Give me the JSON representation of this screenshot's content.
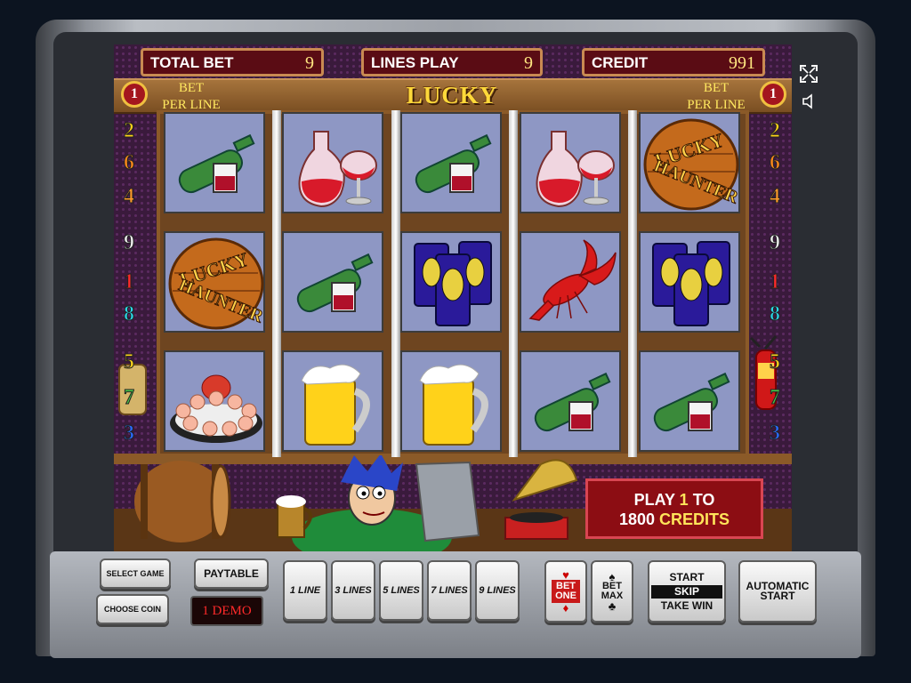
{
  "game": {
    "title": "LUCKY HAUNTER"
  },
  "stats": {
    "total_bet_label": "TOTAL BET",
    "total_bet": "9",
    "lines_play_label": "LINES PLAY",
    "lines_play": "9",
    "credit_label": "CREDIT",
    "credit": "991"
  },
  "bet_per_line": {
    "label_left": "BET\nPER LINE",
    "label_right": "BET\nPER LINE",
    "value_left": "1",
    "value_right": "1"
  },
  "line_numbers_left": [
    "2",
    "6",
    "4",
    "9",
    "1",
    "8",
    "5",
    "7",
    "3"
  ],
  "line_numbers_right": [
    "2",
    "6",
    "4",
    "9",
    "1",
    "8",
    "5",
    "7",
    "3"
  ],
  "reels": [
    [
      "bottle-wine",
      "lucky-haunter",
      "shrimp-dish"
    ],
    [
      "decanter",
      "bottle-wine",
      "beer-mug"
    ],
    [
      "bottle-wine",
      "beer-cans",
      "beer-mug"
    ],
    [
      "decanter",
      "lobster",
      "bottle-wine"
    ],
    [
      "lucky-haunter",
      "beer-cans",
      "bottle-wine"
    ]
  ],
  "play_message": {
    "line1": "PLAY",
    "num1": "1",
    "to": "TO",
    "num2": "1800",
    "credits": "CREDITS"
  },
  "buttons": {
    "select_game": "SELECT GAME",
    "choose_coin": "CHOOSE COIN",
    "paytable": "PAYTABLE",
    "demo_label": "1 DEMO",
    "line1": "1 LINE",
    "line3": "3 LINES",
    "line5": "5 LINES",
    "line7": "7 LINES",
    "line9": "9 LINES",
    "bet_one_a": "BET",
    "bet_one_b": "ONE",
    "bet_max_a": "BET",
    "bet_max_b": "MAX",
    "start": "START",
    "skip": "SKIP",
    "take_win": "TAKE WIN",
    "auto_a": "AUTOMATIC",
    "auto_b": "START"
  },
  "icons": {
    "fullscreen": "fullscreen-icon",
    "sound": "speaker-icon"
  }
}
